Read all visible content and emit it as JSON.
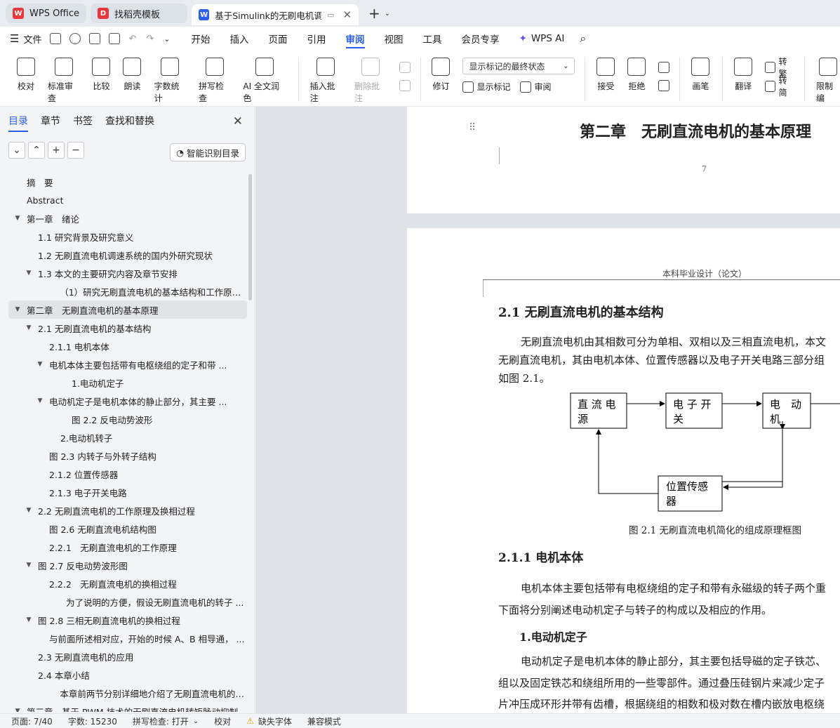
{
  "tabs": [
    {
      "label": "WPS Office",
      "logo": "W",
      "logo_color": "#e8383d"
    },
    {
      "label": "找稻壳模板",
      "logo": "D",
      "logo_color": "#e8383d"
    },
    {
      "label": "基于Simulink的无刷电机调速",
      "logo": "W",
      "logo_color": "#2c5ee8"
    }
  ],
  "menubar": {
    "file": "文件",
    "tabs": [
      "开始",
      "插入",
      "页面",
      "引用",
      "审阅",
      "视图",
      "工具",
      "会员专享"
    ],
    "active_tab": "审阅",
    "wps_ai": "WPS AI"
  },
  "ribbon": {
    "proofread": "校对",
    "std_review": "标准审查",
    "compare": "比较",
    "read_aloud": "朗读",
    "word_count": "字数统计",
    "spell_check": "拼写检查",
    "ai_polish": "AI 全文润色",
    "insert_comment": "插入批注",
    "delete_comment": "删除批注",
    "revise": "修订",
    "display_select": "显示标记的最终状态",
    "show_markup": "显示标记",
    "review": "审阅",
    "accept": "接受",
    "reject": "拒绝",
    "pen": "画笔",
    "translate": "翻译",
    "to_traditional": "转繁",
    "to_simplified": "转简",
    "restrict_edit": "限制编"
  },
  "panel": {
    "tabs": [
      "目录",
      "章节",
      "书签",
      "查找和替换"
    ],
    "smart_toc": "智能识别目录",
    "toc": [
      {
        "text": "摘　要",
        "indent": 0,
        "arrow": ""
      },
      {
        "text": "Abstract",
        "indent": 0,
        "arrow": ""
      },
      {
        "text": "第一章　绪论",
        "indent": 0,
        "arrow": "▼"
      },
      {
        "text": "1.1  研究背景及研究意义",
        "indent": 1,
        "arrow": ""
      },
      {
        "text": "1.2  无刷直流电机调速系统的国内外研究现状",
        "indent": 1,
        "arrow": ""
      },
      {
        "text": "1.3  本文的主要研究内容及章节安排",
        "indent": 1,
        "arrow": "▼"
      },
      {
        "text": "（1）研究无刷直流电机的基本结构和工作原理，...",
        "indent": 3,
        "arrow": ""
      },
      {
        "text": "第二章　无刷直流电机的基本原理",
        "indent": 0,
        "arrow": "▼",
        "selected": true
      },
      {
        "text": "2.1  无刷直流电机的基本结构",
        "indent": 1,
        "arrow": "▼"
      },
      {
        "text": "2.1.1  电机本体",
        "indent": 2,
        "arrow": ""
      },
      {
        "text": "电机本体主要包括带有电枢绕组的定子和带 ...",
        "indent": 2,
        "arrow": "▼"
      },
      {
        "text": "1.电动机定子",
        "indent": 4,
        "arrow": ""
      },
      {
        "text": "电动机定子是电机本体的静止部分，其主要 ...",
        "indent": 2,
        "arrow": "▼"
      },
      {
        "text": "图 2.2  反电动势波形",
        "indent": 4,
        "arrow": ""
      },
      {
        "text": "2.电动机转子",
        "indent": 3,
        "arrow": ""
      },
      {
        "text": "图 2.3  内转子与外转子结构",
        "indent": 2,
        "arrow": ""
      },
      {
        "text": "2.1.2  位置传感器",
        "indent": 2,
        "arrow": ""
      },
      {
        "text": "2.1.3  电子开关电路",
        "indent": 2,
        "arrow": ""
      },
      {
        "text": "2.2  无刷直流电机的工作原理及换相过程",
        "indent": 1,
        "arrow": "▼"
      },
      {
        "text": "图 2.6  无刷直流电机结构图",
        "indent": 2,
        "arrow": ""
      },
      {
        "text": "2.2.1　无刷直流电机的工作原理",
        "indent": 2,
        "arrow": ""
      },
      {
        "text": "图 2.7  反电动势波形图",
        "indent": 1,
        "arrow": "▼"
      },
      {
        "text": "2.2.2　无刷直流电机的换相过程",
        "indent": 2,
        "arrow": ""
      },
      {
        "text": "为了说明的方便，假设无刷直流电机的转子 ...",
        "indent": 3.5,
        "arrow": ""
      },
      {
        "text": "图 2.8  三相无刷直流电机的换相过程",
        "indent": 1,
        "arrow": "▼"
      },
      {
        "text": "与前面所述相对应，开始的时候 A、B 相导通， ...",
        "indent": 2,
        "arrow": ""
      },
      {
        "text": "2.3  无刷直流电机的应用",
        "indent": 1,
        "arrow": ""
      },
      {
        "text": "2.4  本章小结",
        "indent": 1,
        "arrow": ""
      },
      {
        "text": "本章前两节分别详细地介绍了无刷直流电机的结 ...",
        "indent": 3,
        "arrow": ""
      },
      {
        "text": "第三章　基于 PWM 技术的无刷直流电机转矩脉动抑制",
        "indent": 0,
        "arrow": "▼"
      }
    ]
  },
  "document": {
    "page1_heading": "第二章　无刷直流电机的基本原理",
    "page1_number": "7",
    "header": "本科毕业设计（论文）",
    "h_2_1": "2.1  无刷直流电机的基本结构",
    "para1_l1": "无刷直流电机由其相数可分为单相、双相以及三相直流电机，本文",
    "para1_l2": "无刷直流电机，其由电机本体、位置传感器以及电子开关电路三部分组",
    "para1_l3": "如图 2.1。",
    "diagram": {
      "box_dc": [
        "直 流 电",
        "源"
      ],
      "box_switch": [
        "电 子 开",
        "关"
      ],
      "box_motor": [
        "电　动",
        "机"
      ],
      "box_sensor": [
        "位置传感",
        "器"
      ],
      "caption": "图 2.1  无刷直流电机简化的组成原理框图"
    },
    "h_2_1_1": "2.1.1  电机本体",
    "para2_l1": "电机本体主要包括带有电枢绕组的定子和带有永磁级的转子两个重",
    "para2_l2": "下面将分别阐述电动机定子与转子的构成以及相应的作用。",
    "h_stator": "1.电动机定子",
    "para3_l1": "电动机定子是电机本体的静止部分，其主要包括导磁的定子铁芯、",
    "para3_l2": "组以及固定铁芯和绕组所用的一些零部件。通过叠压硅钢片来减少定子",
    "para3_l3": "片冲压成环形并带有齿槽，根据绕组的相数和极对数在槽内嵌放电枢绕"
  },
  "statusbar": {
    "page": "页面: 7/40",
    "words": "字数: 15230",
    "spell": "拼写检查: 打开",
    "proof": "校对",
    "missing_font": "缺失字体",
    "compat": "兼容模式"
  }
}
